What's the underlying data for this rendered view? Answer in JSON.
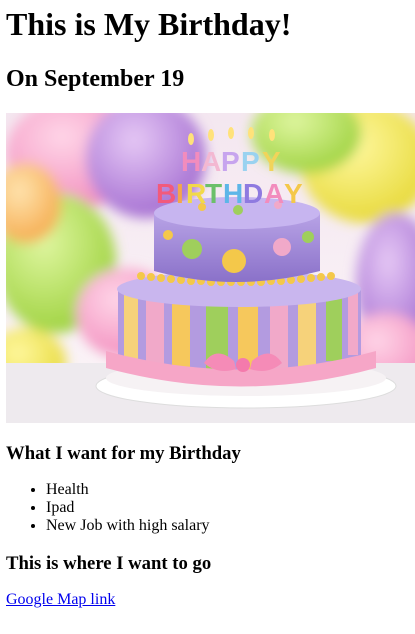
{
  "page": {
    "title": "This is My Birthday!",
    "date_heading": "On September 19",
    "wishlist_heading": "What I want for my Birthday",
    "wishlist": [
      "Health",
      "Ipad",
      "New Job with high salary"
    ],
    "destination_heading": "This is where I want to go",
    "map_link_label": "Google Map link"
  },
  "image": {
    "cake_text": "HAPPY BIRTHDAY",
    "subject": "birthday-cake-with-balloons"
  },
  "colors": {
    "link": "#0000ee",
    "text": "#000000"
  }
}
